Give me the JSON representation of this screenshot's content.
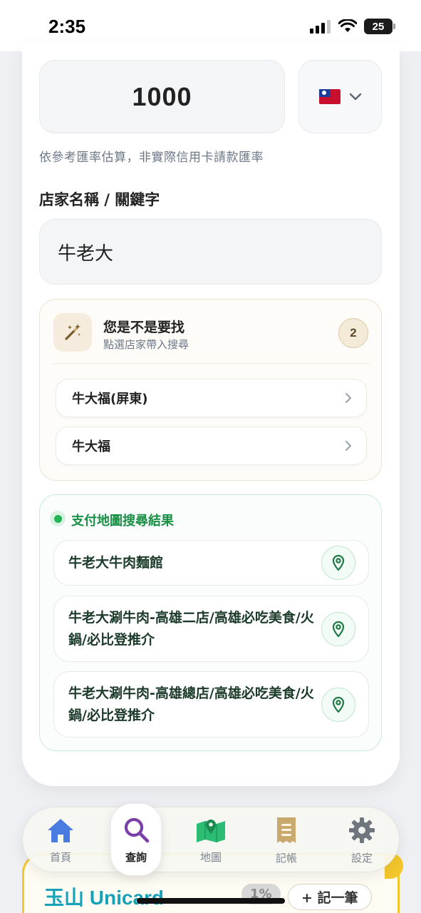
{
  "status_bar": {
    "time": "2:35",
    "battery": "25"
  },
  "converter": {
    "amount": "1000",
    "currency_flag_icon": "taiwan-flag-icon",
    "rate_note": "依參考匯率估算，非實際信用卡請款匯率"
  },
  "search": {
    "label": "店家名稱 / 關鍵字",
    "value": "牛老大"
  },
  "suggestions": {
    "title": "您是不是要找",
    "subtitle": "點選店家帶入搜尋",
    "count": "2",
    "items": [
      {
        "label": "牛大福(屏東)"
      },
      {
        "label": "牛大福"
      }
    ]
  },
  "results": {
    "title": "支付地圖搜尋結果",
    "items": [
      {
        "label": "牛老大牛肉麵館"
      },
      {
        "label": "牛老大涮牛肉-高雄二店/高雄必吃美食/火鍋/必比登推介"
      },
      {
        "label": "牛老大涮牛肉-高雄總店/高雄必吃美食/火鍋/必比登推介"
      }
    ]
  },
  "underlying_card": {
    "logo": "玉山 Unicard",
    "percent": "1%",
    "add_button": "+ 記一筆"
  },
  "nav": {
    "items": [
      {
        "label": "首頁",
        "icon": "home-icon",
        "color": "#4a7be0"
      },
      {
        "label": "查詢",
        "icon": "search-icon",
        "color": "#7b3fa8"
      },
      {
        "label": "地圖",
        "icon": "map-pin-icon",
        "color": "#2bbd73"
      },
      {
        "label": "記帳",
        "icon": "receipt-icon",
        "color": "#c9a96e"
      },
      {
        "label": "設定",
        "icon": "gear-icon",
        "color": "#6e757d"
      }
    ],
    "active_index": 1
  },
  "colors": {
    "accent_green": "#22b455",
    "suggest_border": "#eee3cf",
    "results_border": "#c9ecd6"
  }
}
